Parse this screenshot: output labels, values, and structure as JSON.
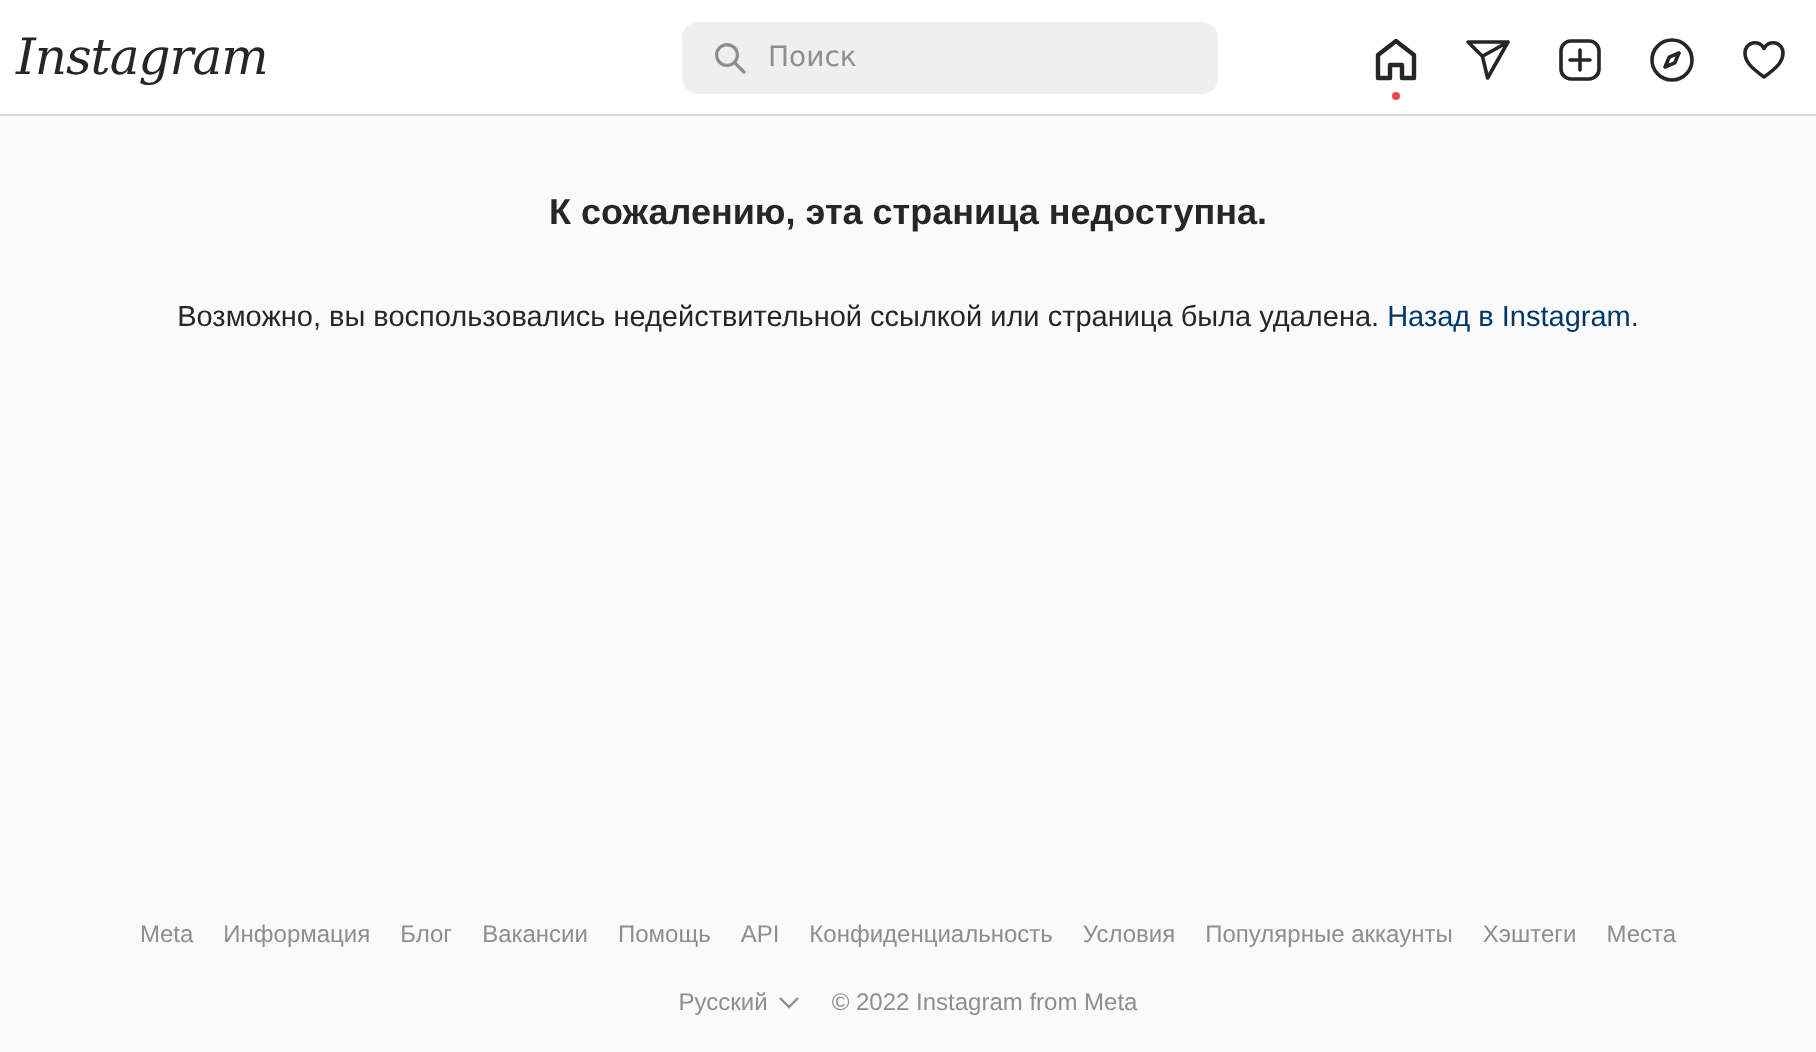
{
  "header": {
    "logo": "Instagram",
    "search": {
      "placeholder": "Поиск"
    },
    "nav": [
      {
        "kind": "home",
        "selected": true
      },
      {
        "kind": "send",
        "selected": false
      },
      {
        "kind": "add",
        "selected": false
      },
      {
        "kind": "explore",
        "selected": false
      },
      {
        "kind": "activity",
        "selected": false
      }
    ]
  },
  "error": {
    "title": "К сожалению, эта страница недоступна.",
    "message": "Возможно, вы воспользовались недействительной ссылкой или страница была удалена.",
    "link": "Назад в Instagram."
  },
  "footer": {
    "links": [
      "Meta",
      "Информация",
      "Блог",
      "Вакансии",
      "Помощь",
      "API",
      "Конфиденциальность",
      "Условия",
      "Популярные аккаунты",
      "Хэштеги",
      "Места"
    ],
    "language": "Русский",
    "copyright": "© 2022 Instagram from Meta"
  }
}
